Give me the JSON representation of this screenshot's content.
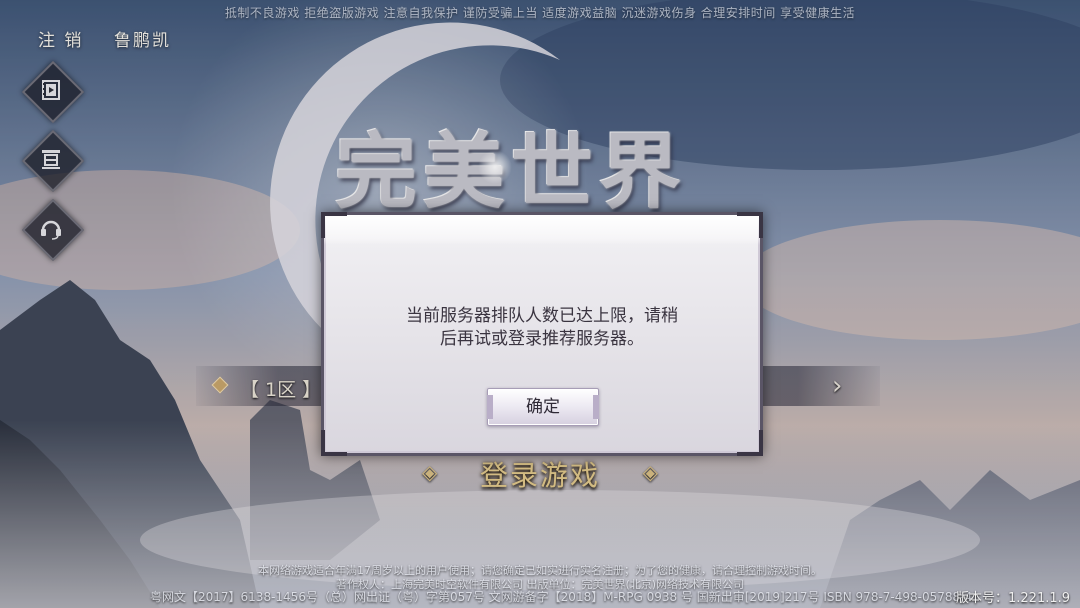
{
  "health_tip": "抵制不良游戏 拒绝盗版游戏 注意自我保护 谨防受骗上当 适度游戏益脑 沉迷游戏伤身 合理安排时间 享受健康生活",
  "top": {
    "logout_label": "注 销",
    "username": "鲁鹏凯"
  },
  "side_buttons": {
    "video_icon": "film-icon",
    "notice_icon": "notice-board-icon",
    "service_icon": "headset-icon"
  },
  "logo": {
    "title": "完美世界"
  },
  "server": {
    "name": "【 1区 】互",
    "arrow": "›"
  },
  "login": {
    "label": "登录游戏",
    "deco_left": "◈",
    "deco_right": "◈"
  },
  "dialog": {
    "message_line1": "当前服务器排队人数已达上限，请稍",
    "message_line2": "后再试或登录推荐服务器。",
    "ok_label": "确定"
  },
  "footer": {
    "line1": "本网络游戏适合年满17周岁以上的用户使用；请您确定已如实进行实名注册；为了您的健康，请合理控制游戏时间。",
    "line2": "著作权人：上海完美时空软件有限公司 出版单位：完美世界(北京)网络技术有限公司",
    "line3": "粤网文【2017】6138-1456号（总）网出证（粤）字第057号 文网游备字【2018】M-RPG 0938 号 国新出审[2019]217号 ISBN 978-7-498-05788-4",
    "version": "版本号：1.221.1.9"
  },
  "colors": {
    "accent_gold": "#e2c98a",
    "dialog_bg": "#e7e5ea",
    "dialog_border": "#5a5566"
  }
}
